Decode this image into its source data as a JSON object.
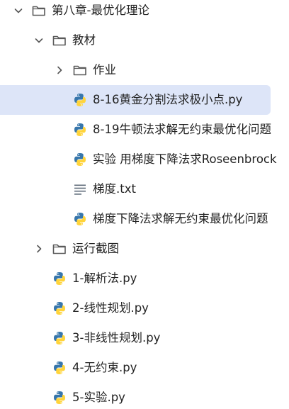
{
  "tree": [
    {
      "id": "chapter8",
      "label": "第八章-最优化理论",
      "kind": "folder",
      "chevron": "down",
      "depth": 0,
      "selected": false
    },
    {
      "id": "textbook",
      "label": "教材",
      "kind": "folder",
      "chevron": "down",
      "depth": 1,
      "selected": false
    },
    {
      "id": "homework",
      "label": "作业",
      "kind": "folder",
      "chevron": "right",
      "depth": 2,
      "selected": false
    },
    {
      "id": "golden-section",
      "label": "8-16黄金分割法求极小点.py",
      "kind": "python",
      "chevron": null,
      "depth": 2,
      "selected": true
    },
    {
      "id": "newton",
      "label": "8-19牛顿法求解无约束最优化问题",
      "kind": "python",
      "chevron": null,
      "depth": 2,
      "selected": false
    },
    {
      "id": "experiment-rosenbrock",
      "label": "实验 用梯度下降法求Roseenbrock",
      "kind": "python",
      "chevron": null,
      "depth": 2,
      "selected": false
    },
    {
      "id": "gradient-txt",
      "label": "梯度.txt",
      "kind": "text",
      "chevron": null,
      "depth": 2,
      "selected": false
    },
    {
      "id": "gradient-descent",
      "label": "梯度下降法求解无约束最优化问题",
      "kind": "python",
      "chevron": null,
      "depth": 2,
      "selected": false
    },
    {
      "id": "run-screenshots",
      "label": "运行截图",
      "kind": "folder",
      "chevron": "right",
      "depth": 1,
      "selected": false
    },
    {
      "id": "analytic",
      "label": "1-解析法.py",
      "kind": "python",
      "chevron": null,
      "depth": 1,
      "selected": false
    },
    {
      "id": "linear-programming",
      "label": "2-线性规划.py",
      "kind": "python",
      "chevron": null,
      "depth": 1,
      "selected": false
    },
    {
      "id": "nonlinear-programming",
      "label": "3-非线性规划.py",
      "kind": "python",
      "chevron": null,
      "depth": 1,
      "selected": false
    },
    {
      "id": "unconstrained",
      "label": "4-无约束.py",
      "kind": "python",
      "chevron": null,
      "depth": 1,
      "selected": false
    },
    {
      "id": "experiment",
      "label": "5-实验.py",
      "kind": "python",
      "chevron": null,
      "depth": 1,
      "selected": false
    }
  ],
  "icon_names": {
    "folder": "folder-icon",
    "python": "python-file-icon",
    "text": "text-file-icon",
    "down": "chevron-down-icon",
    "right": "chevron-right-icon"
  },
  "colors": {
    "selected_background": "#dde5f8",
    "python_blue": "#3776ab",
    "python_yellow": "#ffd43b",
    "folder_outline": "#5a5a5a",
    "text_icon": "#5f6b7a"
  }
}
